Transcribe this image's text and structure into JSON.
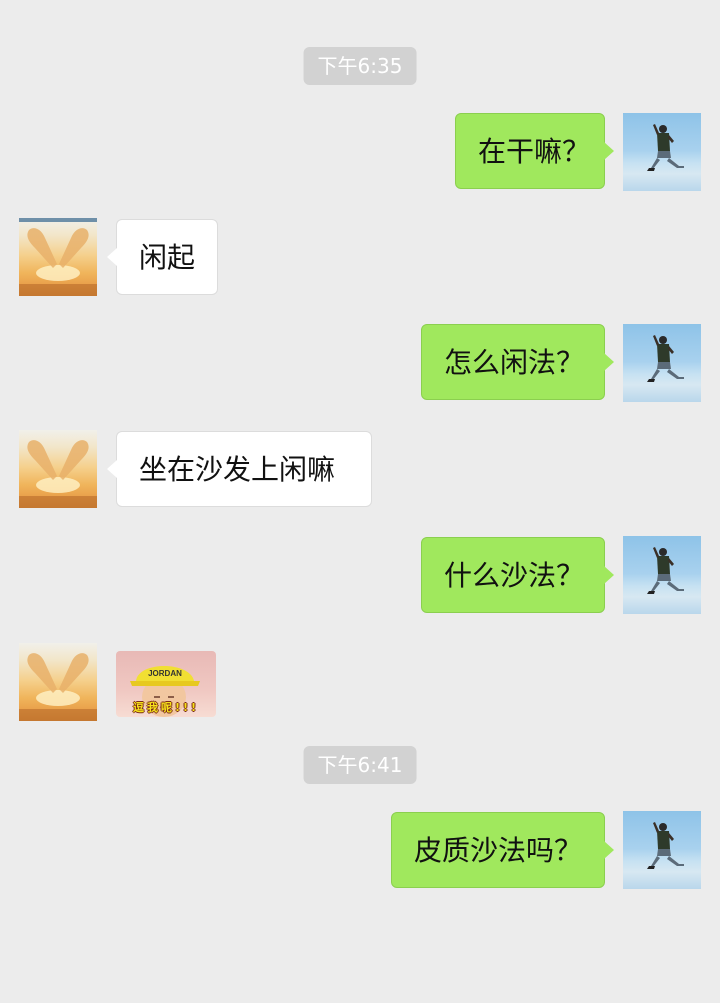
{
  "chat": {
    "timestamps": [
      "下午6:35",
      "下午6:41"
    ],
    "messages": [
      {
        "sender": "self",
        "text": "在干嘛？"
      },
      {
        "sender": "other",
        "text": "闲起"
      },
      {
        "sender": "self",
        "text": "怎么闲法？"
      },
      {
        "sender": "other",
        "text": "坐在沙发上闲嘛"
      },
      {
        "sender": "self",
        "text": "什么沙法？"
      },
      {
        "sender": "other",
        "type": "sticker",
        "cap_text": "JORDAN",
        "caption": "逗我呢!!!"
      },
      {
        "sender": "self",
        "text": "皮质沙法吗？"
      }
    ]
  },
  "colors": {
    "background": "#ececec",
    "self_bubble": "#a0e85d",
    "other_bubble": "#ffffff",
    "timestamp_bg": "#d2d2d2"
  },
  "avatars": {
    "self_icon": "kneeling-person-photo-icon",
    "other_icon": "heart-hands-sunset-icon"
  }
}
